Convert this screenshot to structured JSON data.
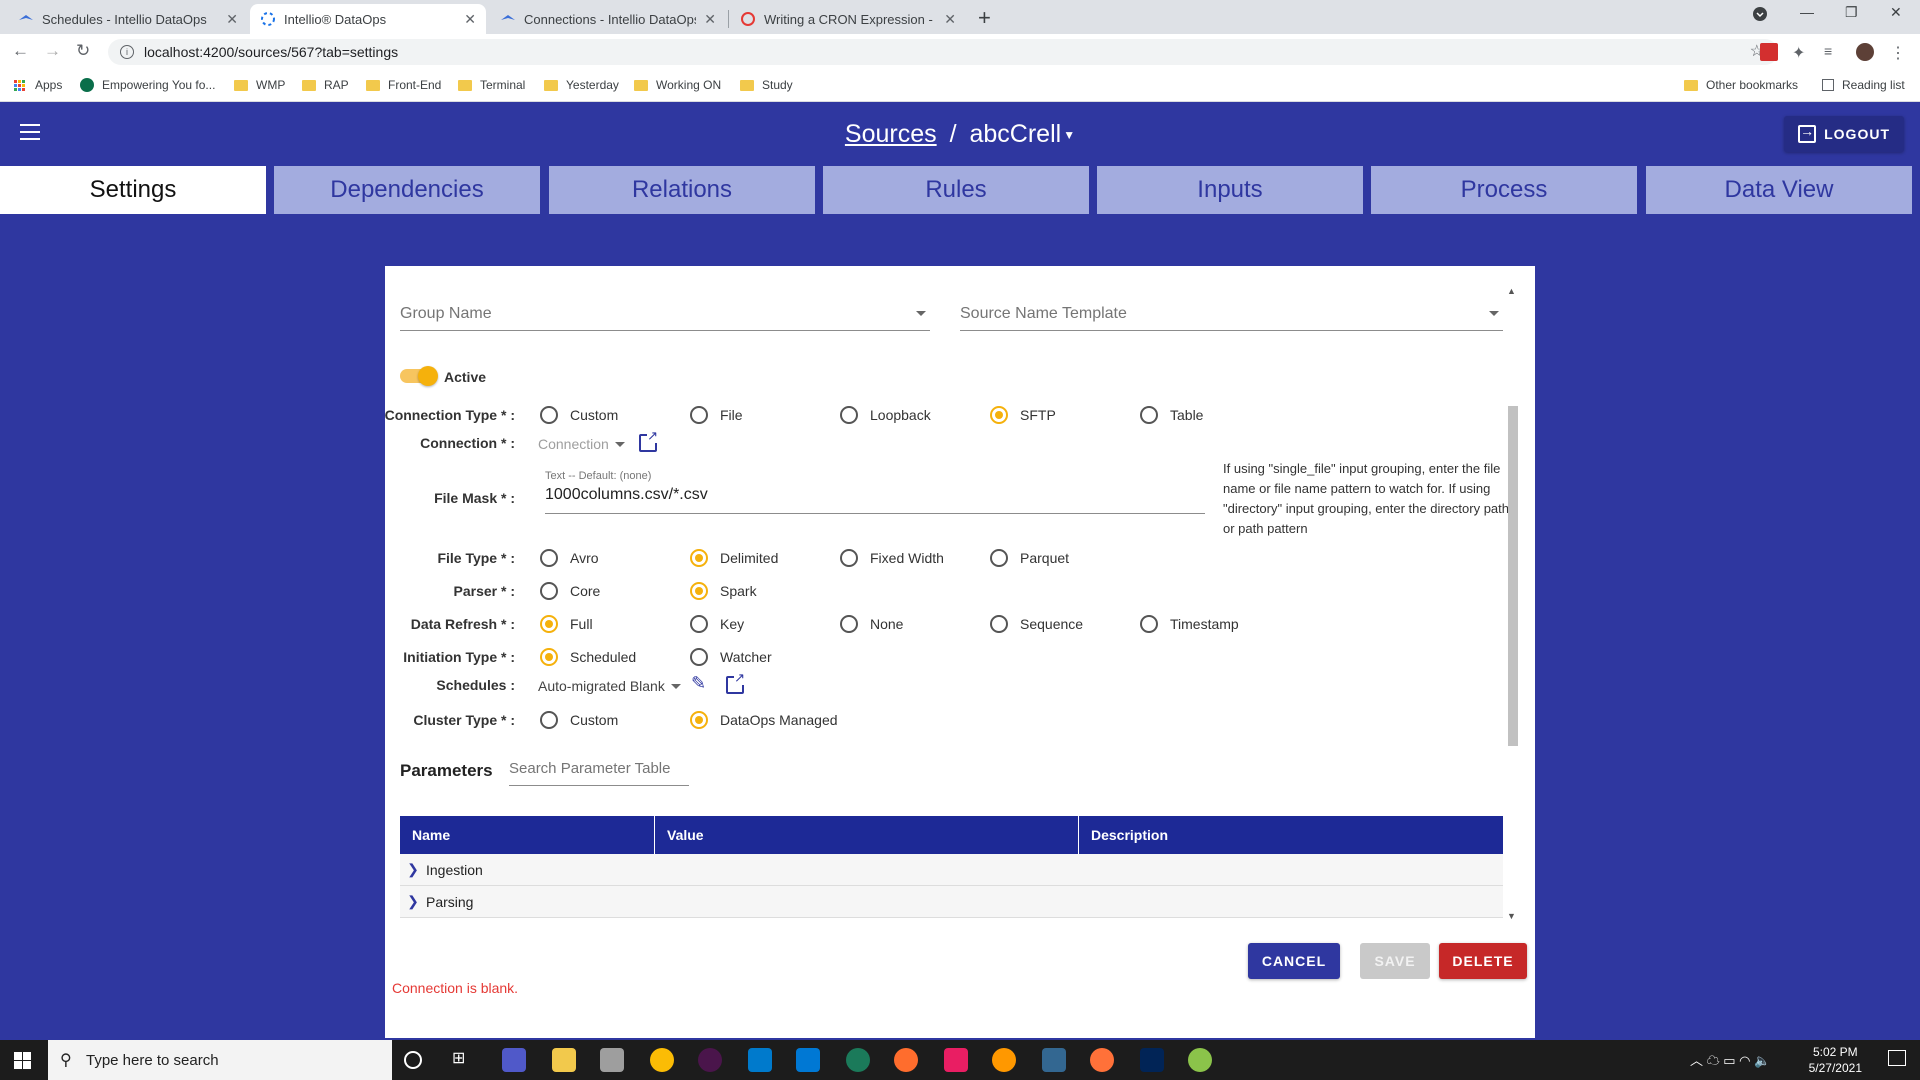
{
  "browser": {
    "tabs": [
      {
        "title": "Schedules - Intellio DataOps"
      },
      {
        "title": "Intellio® DataOps"
      },
      {
        "title": "Connections - Intellio DataOps"
      },
      {
        "title": "Writing a CRON Expression - Co"
      }
    ],
    "url": "localhost:4200/sources/567?tab=settings",
    "bookmarks": [
      "Apps",
      "Empowering You fo...",
      "WMP",
      "RAP",
      "Front-End",
      "Terminal",
      "Yesterday",
      "Working ON",
      "Study"
    ],
    "other_bookmarks": "Other bookmarks",
    "reading_list": "Reading list"
  },
  "header": {
    "breadcrumb_root": "Sources",
    "separator": "/",
    "breadcrumb_current": "abcCrell",
    "logout_label": "LOGOUT"
  },
  "tabs": [
    "Settings",
    "Dependencies",
    "Relations",
    "Rules",
    "Inputs",
    "Process",
    "Data View"
  ],
  "form": {
    "group_name_placeholder": "Group Name",
    "source_template_placeholder": "Source Name Template",
    "active_label": "Active",
    "connection_type": {
      "label": "Connection Type * :",
      "options": [
        "Custom",
        "File",
        "Loopback",
        "SFTP",
        "Table"
      ],
      "selected": "SFTP"
    },
    "connection": {
      "label": "Connection * :",
      "placeholder": "Connection"
    },
    "file_mask": {
      "label": "File Mask * :",
      "hint": "Text -- Default: (none)",
      "value": "1000columns.csv/*.csv"
    },
    "file_mask_help": "If using \"single_file\" input grouping, enter the file name or file name pattern to watch for. If using \"directory\" input grouping, enter the directory path or path pattern",
    "file_type": {
      "label": "File Type * :",
      "options": [
        "Avro",
        "Delimited",
        "Fixed Width",
        "Parquet"
      ],
      "selected": "Delimited"
    },
    "parser": {
      "label": "Parser * :",
      "options": [
        "Core",
        "Spark"
      ],
      "selected": "Spark"
    },
    "data_refresh": {
      "label": "Data Refresh * :",
      "options": [
        "Full",
        "Key",
        "None",
        "Sequence",
        "Timestamp"
      ],
      "selected": "Full"
    },
    "initiation_type": {
      "label": "Initiation Type * :",
      "options": [
        "Scheduled",
        "Watcher"
      ],
      "selected": "Scheduled"
    },
    "schedules": {
      "label": "Schedules :",
      "value": "Auto-migrated Blank"
    },
    "cluster_type": {
      "label": "Cluster Type * :",
      "options": [
        "Custom",
        "DataOps Managed"
      ],
      "selected": "DataOps Managed"
    }
  },
  "parameters": {
    "title": "Parameters",
    "search_placeholder": "Search Parameter Table",
    "columns": [
      "Name",
      "Value",
      "Description"
    ],
    "rows": [
      "Ingestion",
      "Parsing"
    ]
  },
  "actions": {
    "cancel": "CANCEL",
    "save": "SAVE",
    "delete": "DELETE"
  },
  "error_message": "Connection is blank.",
  "taskbar": {
    "search_placeholder": "Type here to search",
    "time": "5:02 PM",
    "date": "5/27/2021"
  },
  "colors": {
    "primary": "#2f37a0",
    "accent": "#f5b10c",
    "danger": "#c62828",
    "tab_inactive": "#a3acdf"
  }
}
